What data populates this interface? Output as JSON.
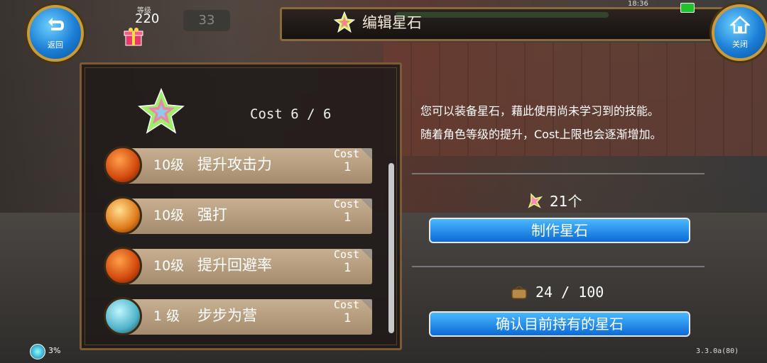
{
  "header": {
    "title": "编辑星石",
    "level_label": "等级",
    "level_value": "220",
    "hp_slot": "33",
    "time": "18:36"
  },
  "buttons": {
    "back": "返回",
    "close": "关闭"
  },
  "left_panel": {
    "cost_summary": "Cost 6 / 6",
    "skills": [
      {
        "level": "10级",
        "name": "提升攻击力",
        "cost_label": "Cost",
        "cost": "1"
      },
      {
        "level": "10级",
        "name": "强打",
        "cost_label": "Cost",
        "cost": "1"
      },
      {
        "level": "10级",
        "name": "提升回避率",
        "cost_label": "Cost",
        "cost": "1"
      },
      {
        "level": "1 级",
        "name": "步步为营",
        "cost_label": "Cost",
        "cost": "1"
      }
    ]
  },
  "right_panel": {
    "description_line1": "您可以装备星石，藉此使用尚未学习到的技能。",
    "description_line2": "随着角色等级的提升，Cost上限也会逐渐增加。",
    "stone_count": "21个",
    "make_button": "制作星石",
    "inventory_count": "24 / 100",
    "confirm_button": "确认目前持有的星石"
  },
  "footer": {
    "percent": "3%",
    "version": "3.3.0a(80)"
  },
  "colors": {
    "accent_blue": "#0c6ad6",
    "frame_gold": "#c89b3c",
    "skill_bar": "#b69d7e"
  }
}
